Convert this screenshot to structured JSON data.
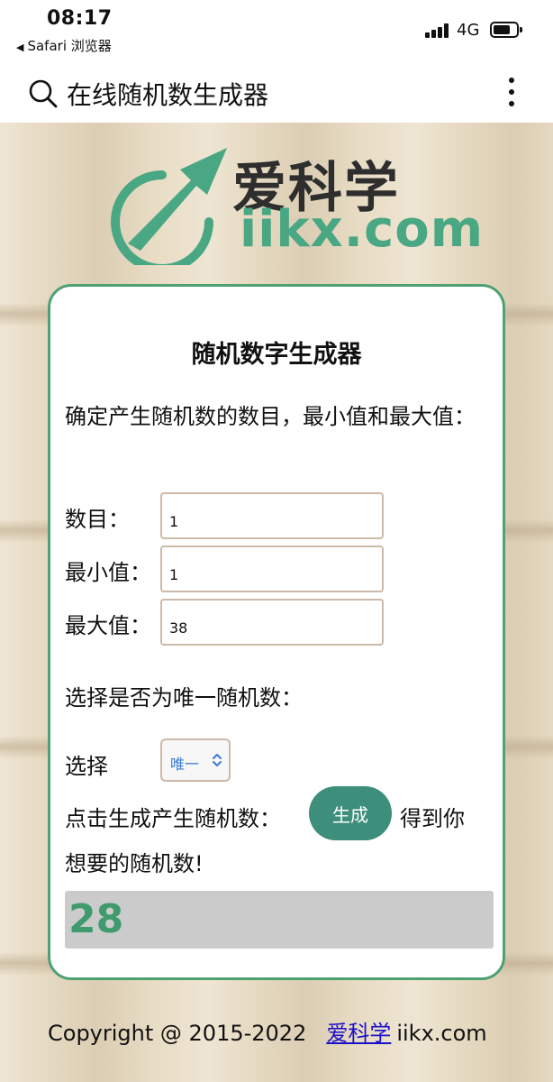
{
  "status_bar": {
    "time": "08:17",
    "back_app": "Safari 浏览器",
    "back_arrow": "◀",
    "network": "4G"
  },
  "search_bar": {
    "title": "在线随机数生成器"
  },
  "logo": {
    "cn": "爱科学",
    "en": "iikx.com",
    "brand_color": "#4aa783"
  },
  "card": {
    "title": "随机数字生成器",
    "instruction": "确定产生随机数的数目，最小值和最大值：",
    "fields": [
      {
        "label": "数目：",
        "value": "1"
      },
      {
        "label": "最小值：",
        "value": "1"
      },
      {
        "label": "最大值：",
        "value": "38"
      }
    ],
    "unique_prompt": "选择是否为唯一随机数：",
    "select_label": "选择",
    "select_value": "唯一",
    "generate_prompt": "点击生成产生随机数：",
    "generate_button": "生成",
    "generate_suffix_line1": "得到你",
    "generate_suffix_line2": "想要的随机数!",
    "result": "28",
    "accent_color": "#4ea173",
    "button_color": "#3d8e7a"
  },
  "footer": {
    "copyright": "Copyright @ 2015-2022",
    "link_text": "爱科学",
    "domain": "iikx.com"
  }
}
